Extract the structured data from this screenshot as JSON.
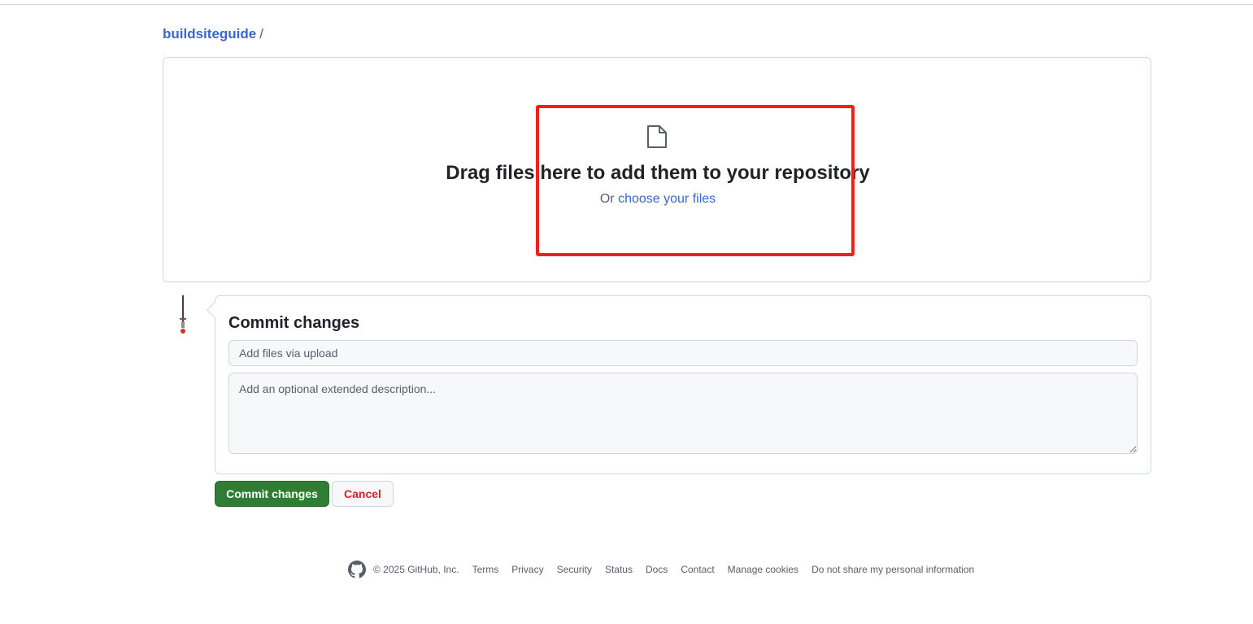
{
  "breadcrumb": {
    "repo": "buildsiteguide",
    "separator": "/"
  },
  "dropzone": {
    "icon": "file-icon",
    "title": "Drag files here to add them to your repository",
    "sub_prefix": "Or",
    "sub_link": "choose your files"
  },
  "highlight": {
    "color": "#f0201a"
  },
  "commit": {
    "title": "Commit changes",
    "message_placeholder": "Add files via upload",
    "description_placeholder": "Add an optional extended description...",
    "commit_button": "Commit changes",
    "cancel_button": "Cancel"
  },
  "footer": {
    "logo": "github-logo-icon",
    "copyright": "© 2025 GitHub, Inc.",
    "links": [
      "Terms",
      "Privacy",
      "Security",
      "Status",
      "Docs",
      "Contact",
      "Manage cookies",
      "Do not share my personal information"
    ]
  },
  "colors": {
    "link": "#3a67c9",
    "commit_button": "#2f7d32",
    "cancel_text": "#cf222e"
  }
}
